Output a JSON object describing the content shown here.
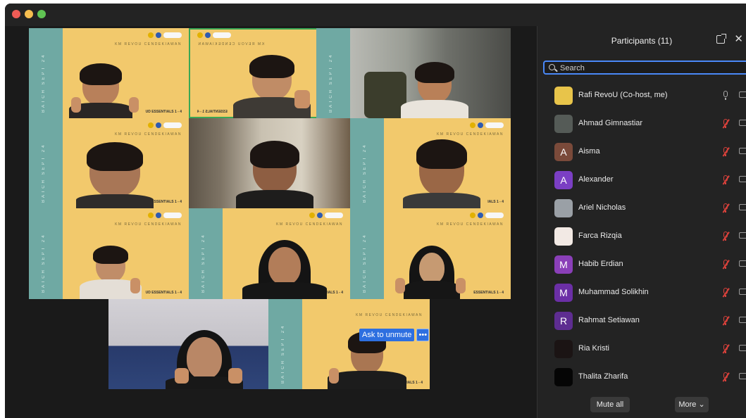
{
  "window": {
    "controls": [
      "close",
      "minimize",
      "zoom"
    ]
  },
  "tiles": {
    "stripe_text": "BATCH SEPT 24",
    "km_text": "KM REVOU CENDEKIAWAN",
    "km_text_mirrored": "KM REVOU CENDEKIAWAN",
    "es_text": "UD ESSENTIALS 1 - 4",
    "es_text_short": "ESSENTIALS 1 - 4",
    "es_text_alt": "IALS 1 - 4",
    "es_text_mirrored": "ESSENTIALS 1 - 4"
  },
  "video_overlay": {
    "unmute_label": "Ask to unmute",
    "more_label": "•••"
  },
  "panel": {
    "title": "Participants (11)",
    "search_placeholder": "Search",
    "close_label": "✕",
    "participants": [
      {
        "name": "Rafi RevoU (Co-host, me)",
        "avatar": "",
        "avatar_color": "#e8c44a",
        "muted": false
      },
      {
        "name": "Ahmad Gimnastiar",
        "avatar": "",
        "avatar_color": "#555b57",
        "muted": true
      },
      {
        "name": "Aisma",
        "avatar": "A",
        "avatar_color": "#7a4a3a",
        "muted": true
      },
      {
        "name": "Alexander",
        "avatar": "A",
        "avatar_color": "#7b3fc4",
        "muted": true
      },
      {
        "name": "Ariel Nicholas",
        "avatar": "",
        "avatar_color": "#9aa0a6",
        "muted": true
      },
      {
        "name": "Farca Rizqia",
        "avatar": "",
        "avatar_color": "#f2e9e4",
        "muted": true
      },
      {
        "name": "Habib Erdian",
        "avatar": "M",
        "avatar_color": "#8a3fb8",
        "muted": true
      },
      {
        "name": "Muhammad Solikhin",
        "avatar": "M",
        "avatar_color": "#6b2fa6",
        "muted": true
      },
      {
        "name": "Rahmat Setiawan",
        "avatar": "R",
        "avatar_color": "#5e2d91",
        "muted": true
      },
      {
        "name": "Ria Kristi",
        "avatar": "",
        "avatar_color": "#1b1414",
        "muted": true
      },
      {
        "name": "Thalita Zharifa",
        "avatar": "",
        "avatar_color": "#050505",
        "muted": true
      }
    ],
    "mute_all_label": "Mute all",
    "more_label": "More ⌄"
  },
  "colors": {
    "active_speaker": "#3aa755",
    "accent_blue": "#2d6fe0",
    "muted_red": "#d9413b",
    "tile_yellow": "#f2c96c",
    "tile_teal": "#6fa9a3"
  }
}
